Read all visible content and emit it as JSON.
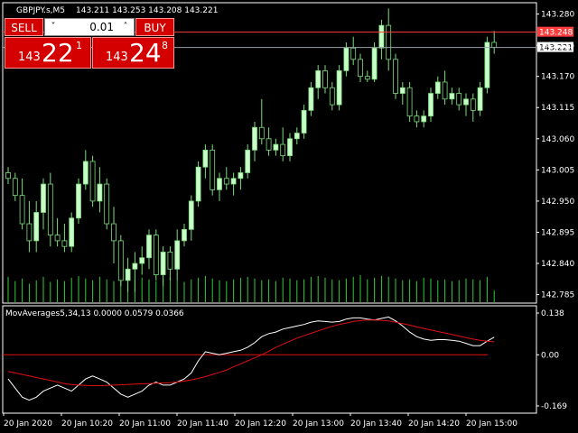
{
  "header": {
    "symbol_info": "GBPJPY.s,M5",
    "ohlc": "143.211 143.253 143.208 143.221"
  },
  "trade_panel": {
    "sell_label": "SELL",
    "buy_label": "BUY",
    "lot": "0.01",
    "lot_down": "˅",
    "lot_up": "˄",
    "sell_quote": {
      "prefix": "143",
      "big": "22",
      "sup": "1"
    },
    "buy_quote": {
      "prefix": "143",
      "big": "24",
      "sup": "8"
    }
  },
  "indicator": {
    "label": "MovAverages5,34,13 0.0000 0.0579 0.0366"
  },
  "colors": {
    "background": "#000000",
    "candle_bull": "#c8ffc8",
    "candle_bear": "#000000",
    "candle_wick": "#7ddc7d",
    "volume": "#33cc33",
    "ask_line": "#ff3c3c",
    "bid_line": "#9aa0a8",
    "fast_ma": "#ffffff",
    "slow_ma": "#e01010",
    "zero_line": "#e01010",
    "sell_button": "#d40000"
  },
  "chart_data": [
    {
      "type": "candlestick",
      "ylim": [
        142.77,
        143.3
      ],
      "y_ticks": [
        "143.280",
        "143.225",
        "143.170",
        "143.115",
        "143.060",
        "143.005",
        "142.950",
        "142.895",
        "142.840",
        "142.785"
      ],
      "ask_price": "143.248",
      "bid_price": "143.221",
      "x_labels": [
        "20 Jan 2020",
        "20 Jan 10:20",
        "20 Jan 11:00",
        "20 Jan 11:40",
        "20 Jan 12:20",
        "20 Jan 13:00",
        "20 Jan 13:40",
        "20 Jan 14:20",
        "20 Jan 15:00"
      ],
      "candles": [
        {
          "o": 143.0,
          "h": 143.01,
          "l": 142.98,
          "c": 142.99
        },
        {
          "o": 142.99,
          "h": 143.0,
          "l": 142.95,
          "c": 142.96
        },
        {
          "o": 142.96,
          "h": 142.99,
          "l": 142.9,
          "c": 142.91
        },
        {
          "o": 142.91,
          "h": 142.95,
          "l": 142.86,
          "c": 142.88
        },
        {
          "o": 142.88,
          "h": 142.95,
          "l": 142.86,
          "c": 142.93
        },
        {
          "o": 142.93,
          "h": 142.99,
          "l": 142.9,
          "c": 142.98
        },
        {
          "o": 142.98,
          "h": 143.0,
          "l": 142.87,
          "c": 142.89
        },
        {
          "o": 142.89,
          "h": 142.92,
          "l": 142.87,
          "c": 142.88
        },
        {
          "o": 142.88,
          "h": 142.91,
          "l": 142.86,
          "c": 142.87
        },
        {
          "o": 142.87,
          "h": 142.93,
          "l": 142.86,
          "c": 142.92
        },
        {
          "o": 142.92,
          "h": 142.99,
          "l": 142.91,
          "c": 142.98
        },
        {
          "o": 142.98,
          "h": 143.04,
          "l": 142.97,
          "c": 143.02
        },
        {
          "o": 143.02,
          "h": 143.03,
          "l": 142.94,
          "c": 142.95
        },
        {
          "o": 142.95,
          "h": 143.01,
          "l": 142.93,
          "c": 142.98
        },
        {
          "o": 142.98,
          "h": 142.99,
          "l": 142.9,
          "c": 142.91
        },
        {
          "o": 142.91,
          "h": 142.94,
          "l": 142.84,
          "c": 142.88
        },
        {
          "o": 142.88,
          "h": 142.89,
          "l": 142.8,
          "c": 142.81
        },
        {
          "o": 142.81,
          "h": 142.85,
          "l": 142.79,
          "c": 142.83
        },
        {
          "o": 142.83,
          "h": 142.86,
          "l": 142.79,
          "c": 142.84
        },
        {
          "o": 142.84,
          "h": 142.87,
          "l": 142.82,
          "c": 142.85
        },
        {
          "o": 142.85,
          "h": 142.9,
          "l": 142.83,
          "c": 142.89
        },
        {
          "o": 142.89,
          "h": 142.9,
          "l": 142.81,
          "c": 142.82
        },
        {
          "o": 142.82,
          "h": 142.87,
          "l": 142.8,
          "c": 142.86
        },
        {
          "o": 142.86,
          "h": 142.87,
          "l": 142.81,
          "c": 142.83
        },
        {
          "o": 142.83,
          "h": 142.9,
          "l": 142.81,
          "c": 142.88
        },
        {
          "o": 142.88,
          "h": 142.91,
          "l": 142.87,
          "c": 142.9
        },
        {
          "o": 142.9,
          "h": 142.96,
          "l": 142.88,
          "c": 142.95
        },
        {
          "o": 142.95,
          "h": 143.02,
          "l": 142.94,
          "c": 143.01
        },
        {
          "o": 143.01,
          "h": 143.05,
          "l": 142.99,
          "c": 143.04
        },
        {
          "o": 143.04,
          "h": 143.05,
          "l": 142.96,
          "c": 142.97
        },
        {
          "o": 142.97,
          "h": 143.0,
          "l": 142.95,
          "c": 142.99
        },
        {
          "o": 142.99,
          "h": 143.01,
          "l": 142.97,
          "c": 142.98
        },
        {
          "o": 142.98,
          "h": 143.0,
          "l": 142.96,
          "c": 142.99
        },
        {
          "o": 142.99,
          "h": 143.01,
          "l": 142.97,
          "c": 143.0
        },
        {
          "o": 143.0,
          "h": 143.05,
          "l": 142.99,
          "c": 143.04
        },
        {
          "o": 143.04,
          "h": 143.09,
          "l": 143.02,
          "c": 143.08
        },
        {
          "o": 143.08,
          "h": 143.13,
          "l": 143.05,
          "c": 143.06
        },
        {
          "o": 143.06,
          "h": 143.08,
          "l": 143.03,
          "c": 143.04
        },
        {
          "o": 143.04,
          "h": 143.06,
          "l": 143.03,
          "c": 143.05
        },
        {
          "o": 143.05,
          "h": 143.08,
          "l": 143.02,
          "c": 143.03
        },
        {
          "o": 143.03,
          "h": 143.07,
          "l": 143.02,
          "c": 143.06
        },
        {
          "o": 143.06,
          "h": 143.08,
          "l": 143.05,
          "c": 143.07
        },
        {
          "o": 143.07,
          "h": 143.12,
          "l": 143.06,
          "c": 143.11
        },
        {
          "o": 143.11,
          "h": 143.16,
          "l": 143.1,
          "c": 143.15
        },
        {
          "o": 143.15,
          "h": 143.19,
          "l": 143.13,
          "c": 143.18
        },
        {
          "o": 143.18,
          "h": 143.19,
          "l": 143.14,
          "c": 143.15
        },
        {
          "o": 143.15,
          "h": 143.16,
          "l": 143.11,
          "c": 143.12
        },
        {
          "o": 143.12,
          "h": 143.19,
          "l": 143.11,
          "c": 143.18
        },
        {
          "o": 143.18,
          "h": 143.23,
          "l": 143.17,
          "c": 143.22
        },
        {
          "o": 143.22,
          "h": 143.24,
          "l": 143.19,
          "c": 143.2
        },
        {
          "o": 143.2,
          "h": 143.21,
          "l": 143.16,
          "c": 143.17
        },
        {
          "o": 143.17,
          "h": 143.18,
          "l": 143.16,
          "c": 143.165
        },
        {
          "o": 143.165,
          "h": 143.23,
          "l": 143.16,
          "c": 143.22
        },
        {
          "o": 143.22,
          "h": 143.27,
          "l": 143.2,
          "c": 143.26
        },
        {
          "o": 143.26,
          "h": 143.29,
          "l": 143.18,
          "c": 143.2
        },
        {
          "o": 143.2,
          "h": 143.21,
          "l": 143.13,
          "c": 143.14
        },
        {
          "o": 143.14,
          "h": 143.16,
          "l": 143.12,
          "c": 143.15
        },
        {
          "o": 143.15,
          "h": 143.16,
          "l": 143.09,
          "c": 143.1
        },
        {
          "o": 143.1,
          "h": 143.11,
          "l": 143.08,
          "c": 143.09
        },
        {
          "o": 143.09,
          "h": 143.11,
          "l": 143.08,
          "c": 143.1
        },
        {
          "o": 143.1,
          "h": 143.15,
          "l": 143.09,
          "c": 143.14
        },
        {
          "o": 143.14,
          "h": 143.17,
          "l": 143.13,
          "c": 143.16
        },
        {
          "o": 143.16,
          "h": 143.18,
          "l": 143.12,
          "c": 143.13
        },
        {
          "o": 143.13,
          "h": 143.15,
          "l": 143.12,
          "c": 143.14
        },
        {
          "o": 143.14,
          "h": 143.15,
          "l": 143.11,
          "c": 143.12
        },
        {
          "o": 143.12,
          "h": 143.14,
          "l": 143.1,
          "c": 143.13
        },
        {
          "o": 143.13,
          "h": 143.14,
          "l": 143.09,
          "c": 143.11
        },
        {
          "o": 143.11,
          "h": 143.16,
          "l": 143.1,
          "c": 143.15
        },
        {
          "o": 143.15,
          "h": 143.24,
          "l": 143.14,
          "c": 143.23
        },
        {
          "o": 143.23,
          "h": 143.25,
          "l": 143.21,
          "c": 143.221
        }
      ],
      "volumes": [
        30,
        25,
        28,
        22,
        26,
        30,
        24,
        27,
        25,
        29,
        31,
        28,
        26,
        30,
        27,
        25,
        28,
        24,
        26,
        29,
        27,
        25,
        28,
        30,
        26,
        24,
        27,
        29,
        31,
        28,
        26,
        25,
        27,
        29,
        30,
        28,
        26,
        27,
        25,
        29,
        28,
        26,
        27,
        30,
        31,
        29,
        27,
        26,
        28,
        30,
        32,
        27,
        29,
        31,
        30,
        28,
        26,
        27,
        25,
        29,
        28,
        26,
        27,
        25,
        26,
        28,
        27,
        26,
        30,
        14
      ]
    },
    {
      "type": "line",
      "ylim": [
        -0.169,
        0.138
      ],
      "y_ticks": [
        "0.138",
        "0.00",
        "-0.169"
      ],
      "zero_level": 0,
      "series": [
        {
          "values": [
            -0.08,
            -0.11,
            -0.14,
            -0.15,
            -0.14,
            -0.12,
            -0.11,
            -0.1,
            -0.11,
            -0.12,
            -0.1,
            -0.08,
            -0.07,
            -0.08,
            -0.09,
            -0.11,
            -0.13,
            -0.14,
            -0.13,
            -0.12,
            -0.1,
            -0.09,
            -0.1,
            -0.1,
            -0.09,
            -0.08,
            -0.06,
            -0.02,
            0.01,
            0.005,
            0.0,
            0.005,
            0.01,
            0.015,
            0.025,
            0.04,
            0.06,
            0.07,
            0.075,
            0.085,
            0.09,
            0.095,
            0.1,
            0.108,
            0.112,
            0.11,
            0.108,
            0.11,
            0.118,
            0.122,
            0.122,
            0.118,
            0.115,
            0.12,
            0.125,
            0.112,
            0.095,
            0.075,
            0.06,
            0.052,
            0.048,
            0.05,
            0.05,
            0.048,
            0.045,
            0.038,
            0.03,
            0.03,
            0.045,
            0.058
          ]
        },
        {
          "values": [
            -0.055,
            -0.06,
            -0.065,
            -0.07,
            -0.075,
            -0.08,
            -0.085,
            -0.09,
            -0.095,
            -0.098,
            -0.1,
            -0.101,
            -0.102,
            -0.102,
            -0.101,
            -0.1,
            -0.099,
            -0.098,
            -0.097,
            -0.096,
            -0.095,
            -0.094,
            -0.093,
            -0.092,
            -0.09,
            -0.087,
            -0.083,
            -0.078,
            -0.072,
            -0.065,
            -0.058,
            -0.05,
            -0.04,
            -0.03,
            -0.02,
            -0.01,
            0.0,
            0.012,
            0.024,
            0.035,
            0.045,
            0.055,
            0.063,
            0.071,
            0.079,
            0.087,
            0.094,
            0.1,
            0.105,
            0.11,
            0.113,
            0.115,
            0.115,
            0.114,
            0.112,
            0.108,
            0.103,
            0.098,
            0.092,
            0.087,
            0.082,
            0.077,
            0.072,
            0.067,
            0.062,
            0.057,
            0.052,
            0.048,
            0.045,
            0.043
          ]
        }
      ]
    }
  ]
}
